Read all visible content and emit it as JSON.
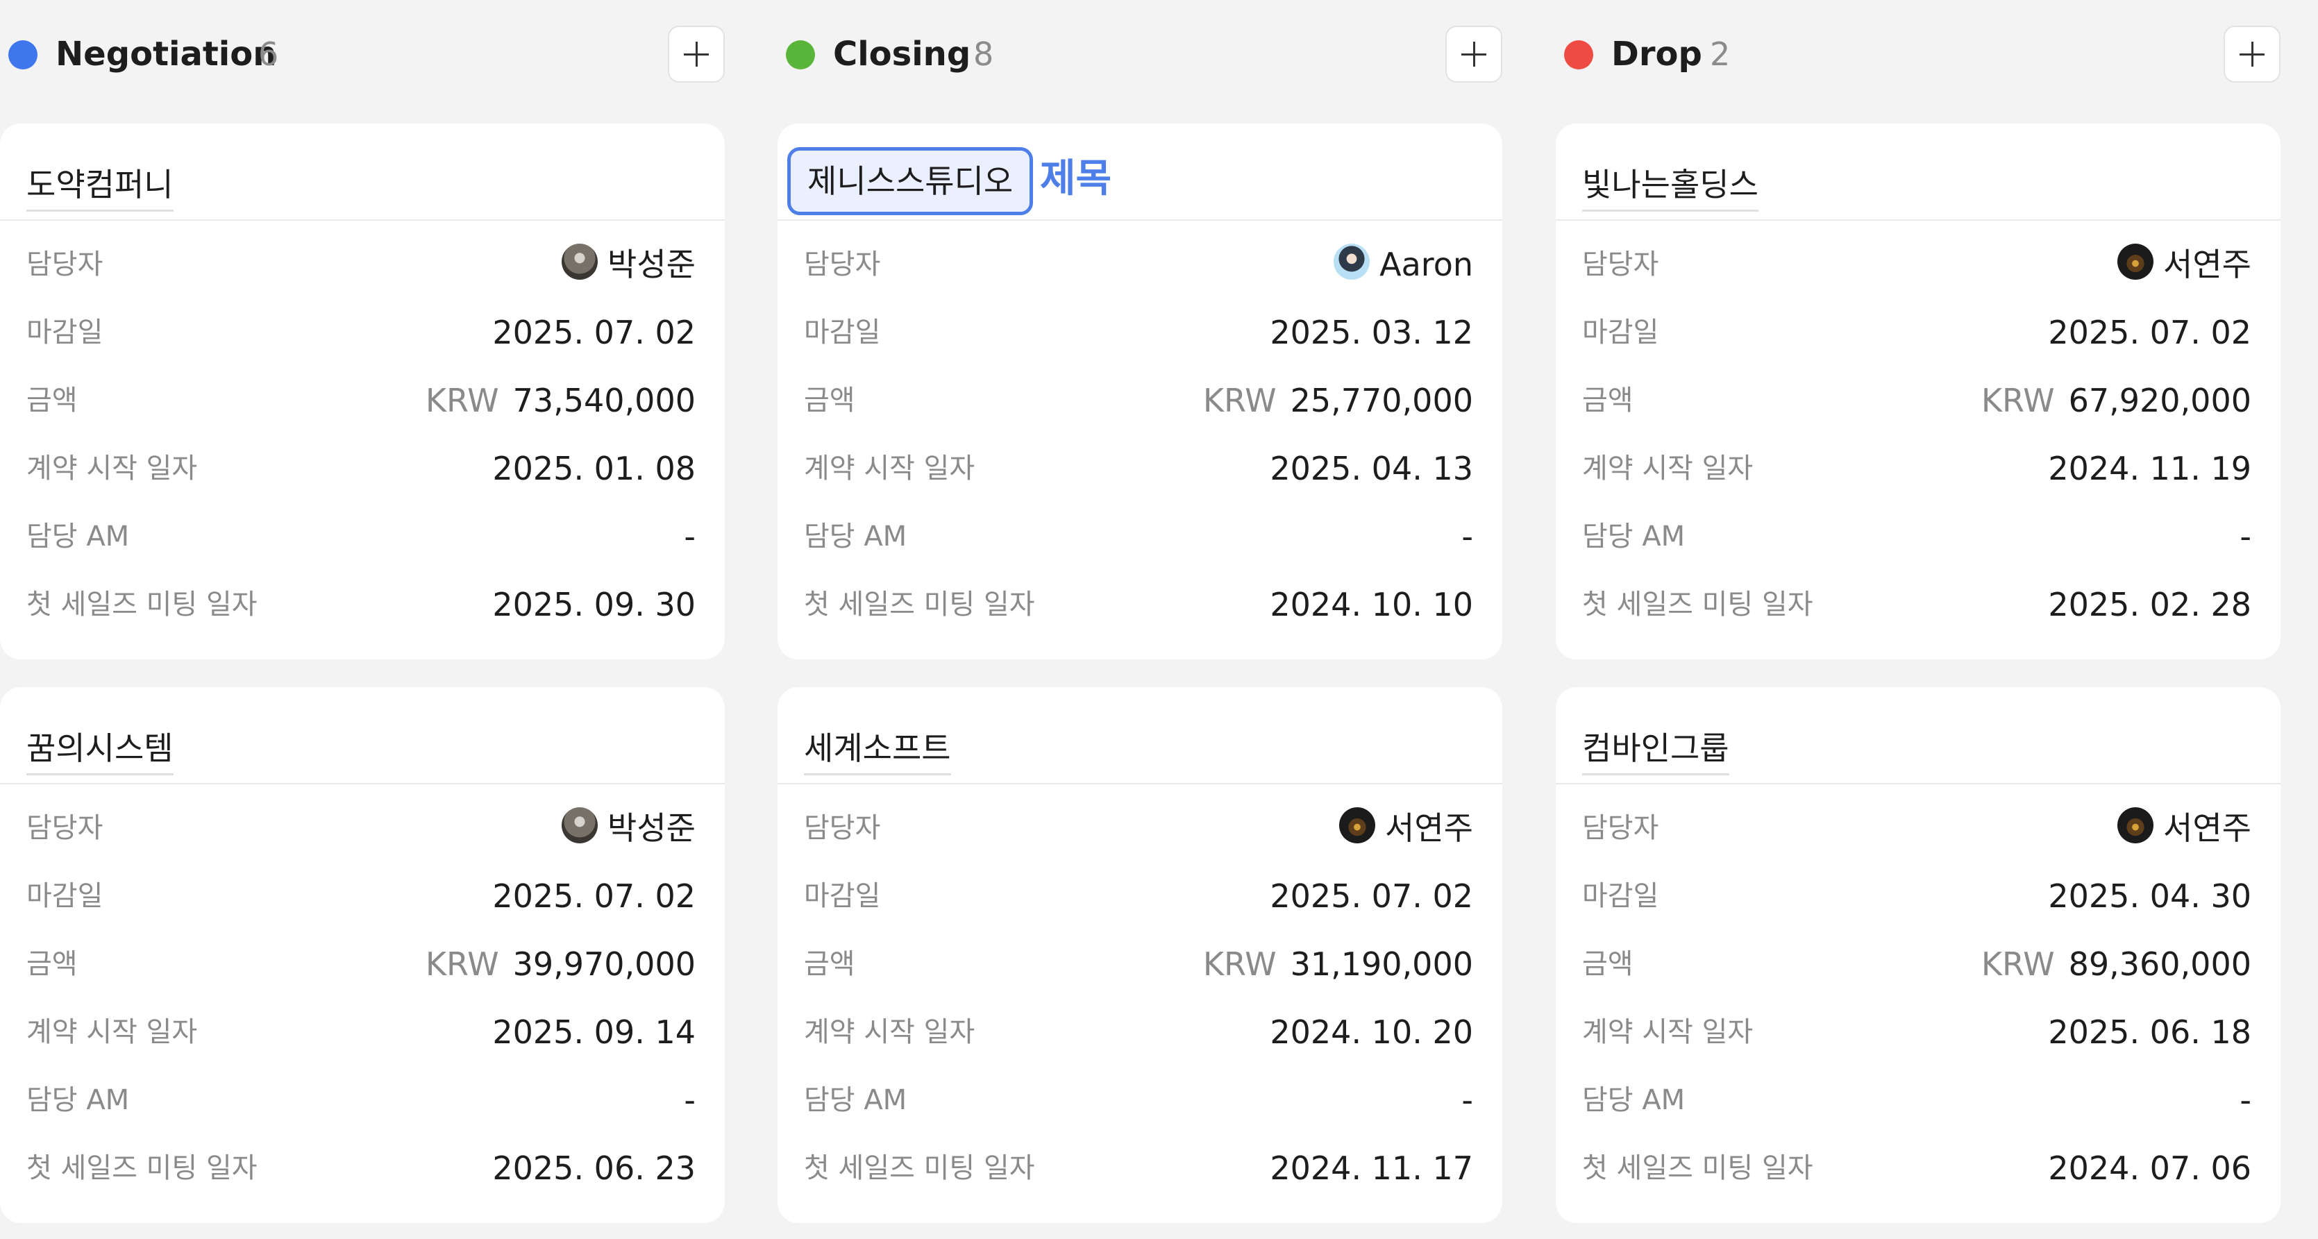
{
  "columns": [
    {
      "title": "Negotiation",
      "count": "6",
      "color": "#3d76ed",
      "cards": [
        {
          "title": "도약컴퍼니",
          "editing": false,
          "fields": {
            "owner_label": "담당자",
            "owner": "박성준",
            "owner_avatar": "avatar-1",
            "due_label": "마감일",
            "due": "2025. 07. 02",
            "amount_label": "금액",
            "currency": "KRW",
            "amount": "73,540,000",
            "contract_label": "계약 시작 일자",
            "contract": "2025. 01. 08",
            "am_label": "담당 AM",
            "am": "-",
            "meeting_label": "첫 세일즈 미팅 일자",
            "meeting": "2025. 09. 30"
          }
        },
        {
          "title": "꿈의시스템",
          "editing": false,
          "fields": {
            "owner_label": "담당자",
            "owner": "박성준",
            "owner_avatar": "avatar-1",
            "due_label": "마감일",
            "due": "2025. 07. 02",
            "amount_label": "금액",
            "currency": "KRW",
            "amount": "39,970,000",
            "contract_label": "계약 시작 일자",
            "contract": "2025. 09. 14",
            "am_label": "담당 AM",
            "am": "-",
            "meeting_label": "첫 세일즈 미팅 일자",
            "meeting": "2025. 06. 23"
          }
        }
      ]
    },
    {
      "title": "Closing",
      "count": "8",
      "color": "#5ab63a",
      "cards": [
        {
          "title": "제니스스튜디오",
          "editing": true,
          "edit_hint": "제목",
          "fields": {
            "owner_label": "담당자",
            "owner": "Aaron",
            "owner_avatar": "avatar-2",
            "due_label": "마감일",
            "due": "2025. 03. 12",
            "amount_label": "금액",
            "currency": "KRW",
            "amount": "25,770,000",
            "contract_label": "계약 시작 일자",
            "contract": "2025. 04. 13",
            "am_label": "담당 AM",
            "am": "-",
            "meeting_label": "첫 세일즈 미팅 일자",
            "meeting": "2024. 10. 10"
          }
        },
        {
          "title": "세계소프트",
          "editing": false,
          "fields": {
            "owner_label": "담당자",
            "owner": "서연주",
            "owner_avatar": "avatar-3",
            "due_label": "마감일",
            "due": "2025. 07. 02",
            "amount_label": "금액",
            "currency": "KRW",
            "amount": "31,190,000",
            "contract_label": "계약 시작 일자",
            "contract": "2024. 10. 20",
            "am_label": "담당 AM",
            "am": "-",
            "meeting_label": "첫 세일즈 미팅 일자",
            "meeting": "2024. 11. 17"
          }
        }
      ]
    },
    {
      "title": "Drop",
      "count": "2",
      "color": "#ee4b42",
      "cards": [
        {
          "title": "빛나는홀딩스",
          "editing": false,
          "fields": {
            "owner_label": "담당자",
            "owner": "서연주",
            "owner_avatar": "avatar-3",
            "due_label": "마감일",
            "due": "2025. 07. 02",
            "amount_label": "금액",
            "currency": "KRW",
            "amount": "67,920,000",
            "contract_label": "계약 시작 일자",
            "contract": "2024. 11. 19",
            "am_label": "담당 AM",
            "am": "-",
            "meeting_label": "첫 세일즈 미팅 일자",
            "meeting": "2025. 02. 28"
          }
        },
        {
          "title": "컴바인그룹",
          "editing": false,
          "fields": {
            "owner_label": "담당자",
            "owner": "서연주",
            "owner_avatar": "avatar-3",
            "due_label": "마감일",
            "due": "2025. 04. 30",
            "amount_label": "금액",
            "currency": "KRW",
            "amount": "89,360,000",
            "contract_label": "계약 시작 일자",
            "contract": "2025. 06. 18",
            "am_label": "담당 AM",
            "am": "-",
            "meeting_label": "첫 세일즈 미팅 일자",
            "meeting": "2024. 07. 06"
          }
        }
      ]
    }
  ]
}
